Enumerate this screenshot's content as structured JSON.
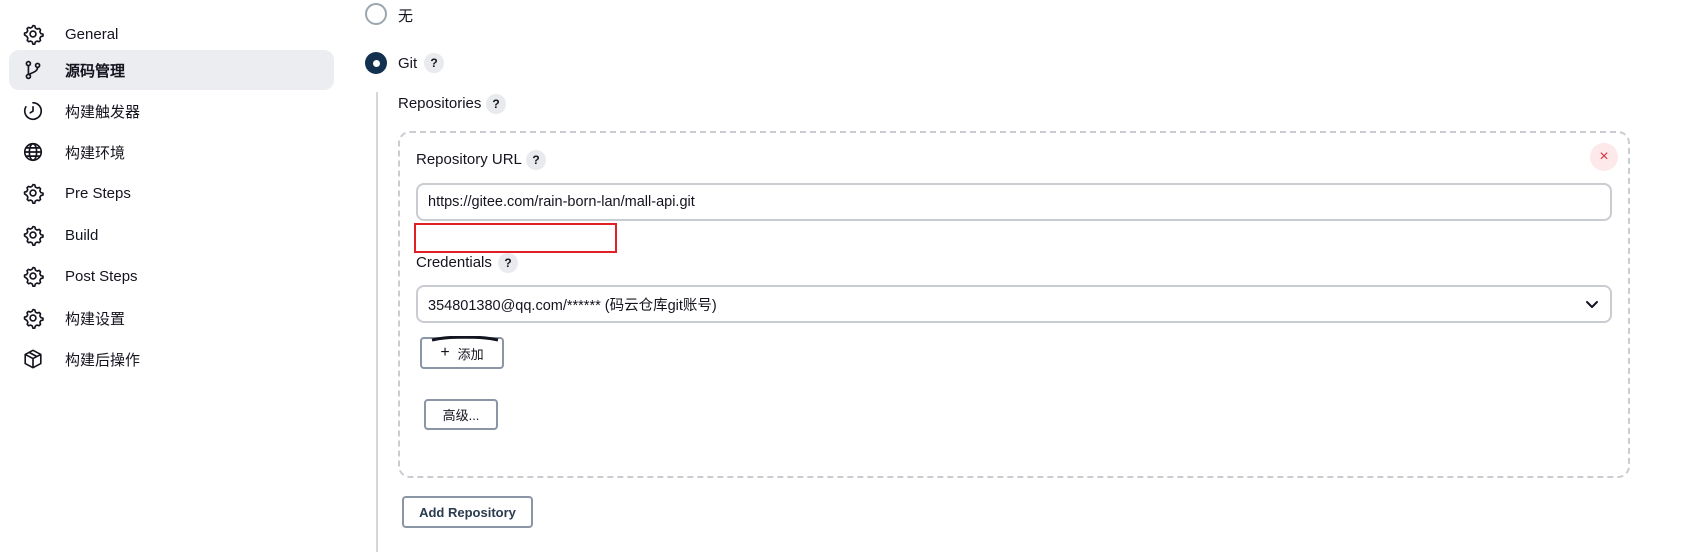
{
  "sidebar": {
    "items": [
      {
        "label": "General",
        "icon": "gear-icon"
      },
      {
        "label": "源码管理",
        "icon": "branch-icon",
        "active": true
      },
      {
        "label": "构建触发器",
        "icon": "clock-icon"
      },
      {
        "label": "构建环境",
        "icon": "globe-icon"
      },
      {
        "label": "Pre Steps",
        "icon": "gear-icon"
      },
      {
        "label": "Build",
        "icon": "gear-icon"
      },
      {
        "label": "Post Steps",
        "icon": "gear-icon"
      },
      {
        "label": "构建设置",
        "icon": "gear-icon"
      },
      {
        "label": "构建后操作",
        "icon": "cube-icon"
      }
    ]
  },
  "scm": {
    "option_none": "无",
    "option_git": "Git",
    "selected": "Git",
    "help": "?",
    "repositories_label": "Repositories",
    "repository_url_label": "Repository URL",
    "repository_url_value": "https://gitee.com/rain-born-lan/mall-api.git",
    "credentials_label": "Credentials",
    "credentials_value": "354801380@qq.com/****** (码云仓库git账号)",
    "add_button": "添加",
    "advanced_button": "高级...",
    "add_repository_button": "Add Repository",
    "close_symbol": "×"
  },
  "colors": {
    "active_nav_bg": "#ebedf0",
    "radio_checked": "#14304f",
    "highlight_border": "#e21f26",
    "close_bg": "#fde8ea",
    "close_fg": "#e0303f"
  }
}
